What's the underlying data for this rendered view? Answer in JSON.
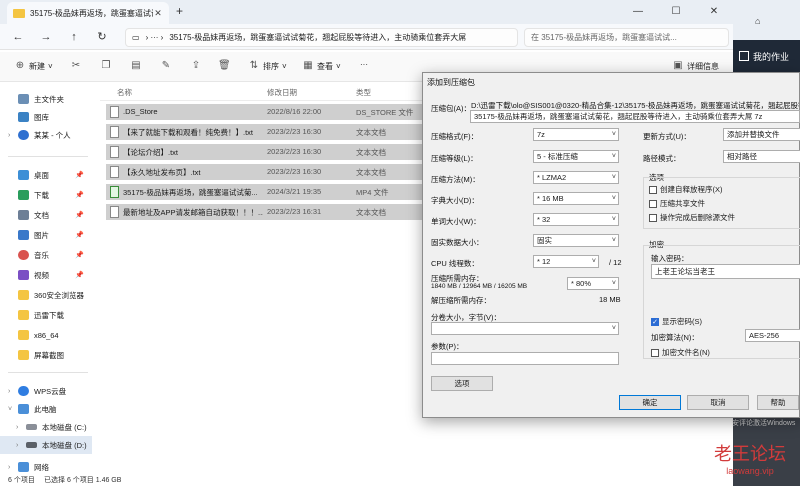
{
  "tab": {
    "title": "35175-极品妹再返场，跳蛋塞逼试试菊",
    "close": "✕",
    "new": "+"
  },
  "window": {
    "minimize": "—",
    "maximize": "☐",
    "close": "✕"
  },
  "address": {
    "path": "35175-极品妹再返场，跳蛋塞逼试试菊花，翘起屁股等待进入，主动骑乘位套弄大屌",
    "search_placeholder": "在 35175-极品妹再返场，跳蛋塞逼试试..."
  },
  "toolbar": {
    "new": "新建",
    "sort": "排序",
    "view": "查看",
    "more": "···",
    "details": "详细信息"
  },
  "sidebar": {
    "items": [
      {
        "label": "主文件夹",
        "icon": "home-icon"
      },
      {
        "label": "图库",
        "icon": "gallery-icon"
      },
      {
        "label": "某某 - 个人",
        "icon": "cloud-icon"
      },
      {
        "label": "桌面",
        "icon": "desktop-icon"
      },
      {
        "label": "下载",
        "icon": "download-icon"
      },
      {
        "label": "文档",
        "icon": "document-icon"
      },
      {
        "label": "图片",
        "icon": "picture-icon"
      },
      {
        "label": "音乐",
        "icon": "music-icon"
      },
      {
        "label": "视频",
        "icon": "video-icon"
      },
      {
        "label": "360安全浏览器",
        "icon": "folder-icon"
      },
      {
        "label": "迅雷下载",
        "icon": "folder-icon"
      },
      {
        "label": "x86_64",
        "icon": "folder-icon"
      },
      {
        "label": "屏幕截图",
        "icon": "folder-icon"
      },
      {
        "label": "WPS云盘",
        "icon": "cloud-drive-icon"
      },
      {
        "label": "此电脑",
        "icon": "computer-icon"
      },
      {
        "label": "本地磁盘 (C:)",
        "icon": "drive-icon"
      },
      {
        "label": "本地磁盘 (D:)",
        "icon": "drive-icon"
      },
      {
        "label": "网络",
        "icon": "network-icon"
      }
    ]
  },
  "files": {
    "headers": {
      "name": "名称",
      "date": "修改日期",
      "type": "类型"
    },
    "rows": [
      {
        "name": ".DS_Store",
        "date": "2022/8/16 22:00",
        "type": "DS_STORE 文件"
      },
      {
        "name": "【来了就能下载和观看！纯免费！】.txt",
        "date": "2023/2/23 16:30",
        "type": "文本文档"
      },
      {
        "name": "【论坛介绍】.txt",
        "date": "2023/2/23 16:30",
        "type": "文本文档"
      },
      {
        "name": "【永久地址发布页】.txt",
        "date": "2023/2/23 16:30",
        "type": "文本文档"
      },
      {
        "name": "35175-极品妹再返场，跳蛋塞逼试试菊...",
        "date": "2024/3/21 19:35",
        "type": "MP4 文件"
      },
      {
        "name": "最新地址及APP请发邮箱自动获取！！！...",
        "date": "2023/2/23 16:31",
        "type": "文本文档"
      }
    ]
  },
  "status": {
    "count": "6 个项目",
    "selected": "已选择 6 个项目  1.46 GB"
  },
  "rightapp": {
    "work": "我的作业"
  },
  "dialog": {
    "title": "添加到压缩包",
    "archive_label": "压缩包(A)：",
    "archive_dir": "D:\\迅雷下载\\olo@SIS001@0320-精品合集-12\\35175-极品妹再返场，跳蛋塞逼试试菊花，翘起屁股等待进入",
    "archive_name": "35175-极品妹再返场，跳蛋塞逼试试菊花，翘起屁股等待进入，主动骑乘位套弄大屌 7z",
    "format_label": "压缩格式(F)：",
    "format_value": "7z",
    "level_label": "压缩等级(L)：",
    "level_value": "5 - 标准压缩",
    "method_label": "压缩方法(M)：",
    "method_value": "* LZMA2",
    "dict_label": "字典大小(D)：",
    "dict_value": "* 16 MB",
    "word_label": "单词大小(W)：",
    "word_value": "* 32",
    "solid_label": "固实数据大小：",
    "solid_value": "固实",
    "cpu_label": "CPU 线程数：",
    "cpu_value": "* 12",
    "cpu_total": "/ 12",
    "mem_label": "压缩所需内存：",
    "mem_detail": "1840 MB / 12964 MB / 16205 MB",
    "mem_pct": "* 80%",
    "decomp_label": "解压缩所需内存：",
    "decomp_value": "18 MB",
    "split_label": "分卷大小，字节(V)：",
    "params_label": "参数(P)：",
    "options_button": "选项",
    "update_label": "更新方式(U)：",
    "update_value": "添加并替换文件",
    "pathmode_label": "路径模式：",
    "pathmode_value": "相对路径",
    "options_group": "选项",
    "opt_sfx": "创建自释放程序(X)",
    "opt_shared": "压缩共享文件",
    "opt_delete": "操作完成后删除源文件",
    "enc_group": "加密",
    "pwd_label": "输入密码：",
    "pwd_value": "上老王论坛当老王",
    "show_pwd": "显示密码(S)",
    "enc_method_label": "加密算法(N)：",
    "enc_method_value": "AES-256",
    "enc_names": "加密文件名(N)",
    "ok": "确定",
    "cancel": "取消",
    "help": "帮助"
  },
  "watermark": {
    "main": "老王论坛",
    "sub": "laowang.vip"
  },
  "faint": "安评论激活Windows"
}
